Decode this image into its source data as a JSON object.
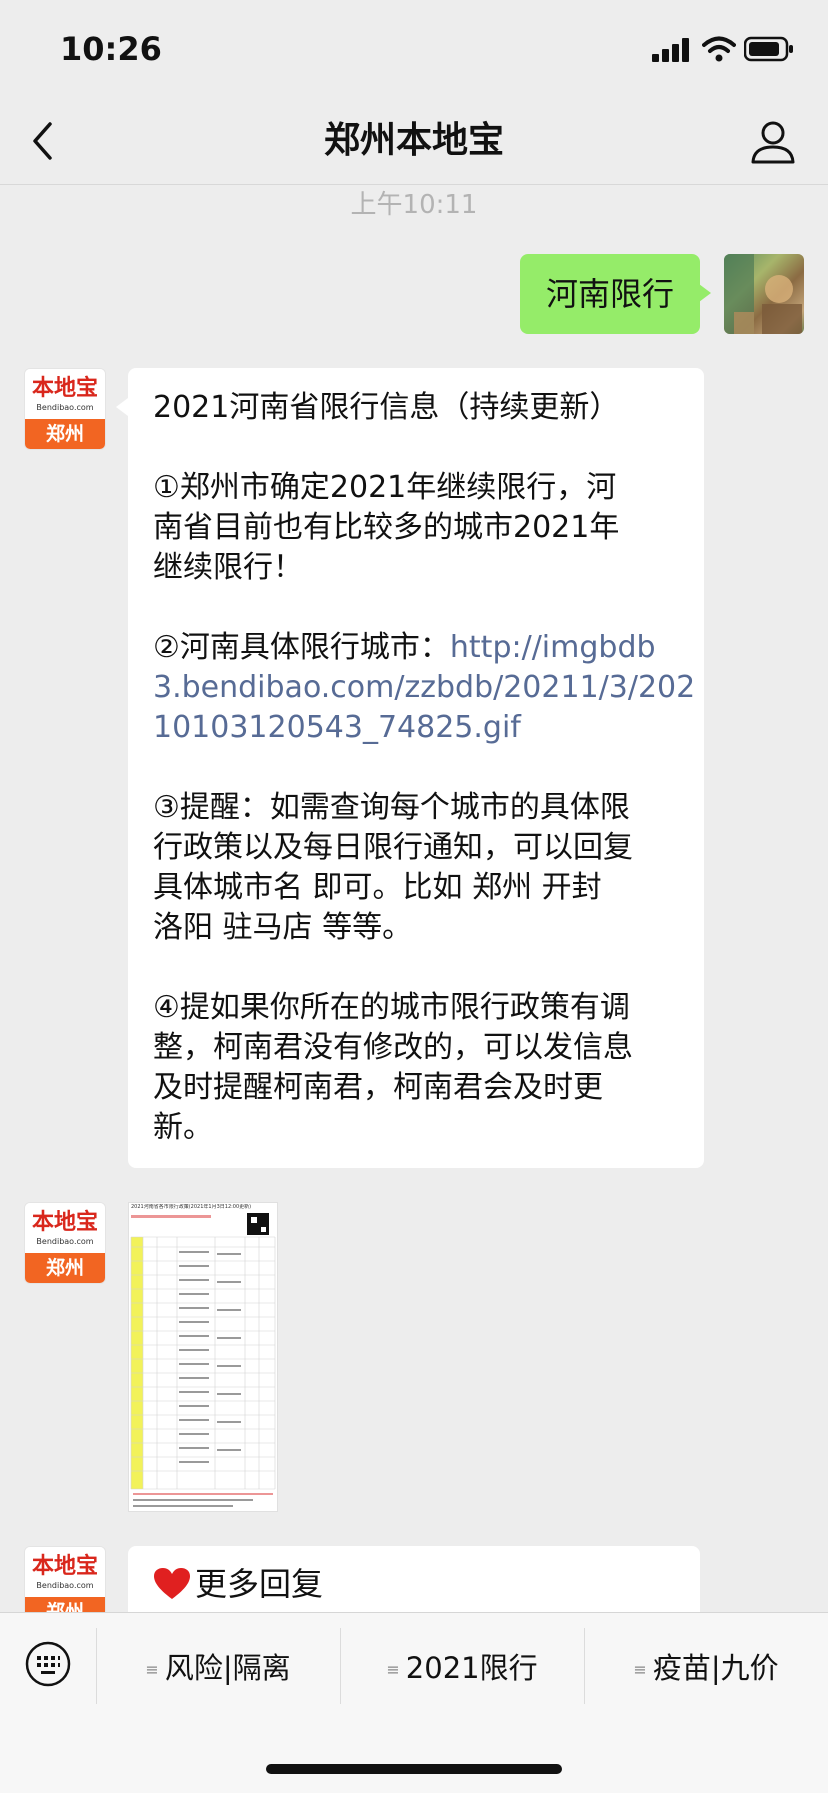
{
  "status": {
    "time": "10:26"
  },
  "nav": {
    "title": "郑州本地宝"
  },
  "timestamp": "上午10:11",
  "sent": {
    "text": "河南限行"
  },
  "bot": {
    "avatar_brand": "本地宝",
    "avatar_site": "Bendibao.com",
    "avatar_city": "郑州"
  },
  "message": {
    "lines": [
      "2021河南省限行信息（持续更新）",
      "①郑州市确定2021年继续限行，河",
      "南省目前也有比较多的城市2021年",
      "继续限行！",
      "②河南具体限行城市：",
      "③提醒：如需查询每个城市的具体限",
      "行政策以及每日限行通知，可以回复",
      " 具体城市名 即可。比如 郑州 开封",
      "洛阳 驻马店 等等。",
      "④提如果你所在的城市限行政策有调",
      "整，柯南君没有修改的，可以发信息",
      "及时提醒柯南君，柯南君会及时更",
      "新。"
    ],
    "link_lines": [
      "http://imgbdb",
      "3.bendibao.com/zzbdb/20211/3/202",
      "10103120543_74825.gif"
    ]
  },
  "image_title": "2021河南省各市限行政策(2021年1月3日12:00更新)",
  "last_message": {
    "text": "更多回复"
  },
  "menu": [
    {
      "label": "风险|隔离"
    },
    {
      "label": "2021限行"
    },
    {
      "label": "疫苗|九价"
    }
  ]
}
